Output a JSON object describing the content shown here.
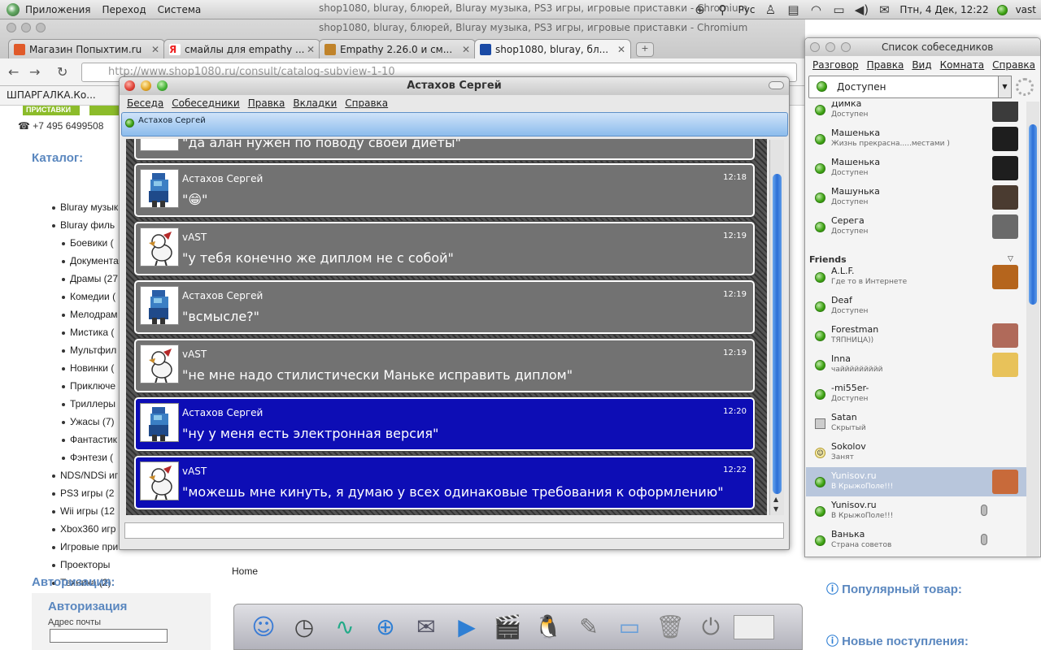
{
  "top_panel": {
    "menus": [
      "Приложения",
      "Переход",
      "Система"
    ],
    "window_title": "shop1080, bluray, блюрей, Bluray музыка, PS3 игры, игровые приставки - Chromium",
    "layout": "Рус",
    "datetime": "Птн, 4 Дек, 12:22",
    "user": "vast"
  },
  "browser": {
    "tabs": [
      {
        "label": "Магазин Попыхтим.ru",
        "color": "#e05a2a"
      },
      {
        "label": "смайлы для empathy ...",
        "color": "#ffffff"
      },
      {
        "label": "Empathy 2.26.0 и см...",
        "color": "#c0832a"
      },
      {
        "label": "shop1080, bluray, бл...",
        "color": "#1a4aa5"
      }
    ],
    "url_host": "http://www.shop1080.ru",
    "url_path": "/consult/catalog-subview-1-10",
    "bookmark": "ШПАРГАЛКА.Ко..."
  },
  "site": {
    "strip1": "ПРИСТАВКИ",
    "phone": "+7 495 6499508",
    "catalog_title": "Каталог:",
    "catalog": [
      {
        "label": "Bluray музык",
        "level": 0
      },
      {
        "label": "Bluray филь",
        "level": 0
      },
      {
        "label": "Боевики (",
        "level": 1
      },
      {
        "label": "Документа",
        "level": 1
      },
      {
        "label": "Драмы (27",
        "level": 1
      },
      {
        "label": "Комедии (",
        "level": 1
      },
      {
        "label": "Мелодрам",
        "level": 1
      },
      {
        "label": "Мистика (",
        "level": 1
      },
      {
        "label": "Мультфил",
        "level": 1
      },
      {
        "label": "Новинки (",
        "level": 1
      },
      {
        "label": "Приключе",
        "level": 1
      },
      {
        "label": "Триллеры",
        "level": 1
      },
      {
        "label": "Ужасы (7)",
        "level": 1
      },
      {
        "label": "Фантастик",
        "level": 1
      },
      {
        "label": "Фэнтези (",
        "level": 1
      },
      {
        "label": "NDS/NDSi иг",
        "level": 0
      },
      {
        "label": "PS3 игры (2",
        "level": 0
      },
      {
        "label": "Wii игры (12",
        "level": 0
      },
      {
        "label": "Xbox360 игр",
        "level": 0
      },
      {
        "label": "Игровые при",
        "level": 0
      },
      {
        "label": "Проекторы",
        "level": 0
      },
      {
        "label": "Техника (2)",
        "level": 0
      }
    ],
    "auth_header": "Авторизация:",
    "auth_title": "Авторизация",
    "email_label": "Адрес почты",
    "home": "Home",
    "popular": "Популярный товар:",
    "new_arrivals": "Новые поступления:"
  },
  "chat": {
    "title": "Астахов Сергей",
    "menu": [
      "Беседа",
      "Собеседники",
      "Правка",
      "Вкладки",
      "Справка"
    ],
    "tab_label": "Астахов Сергей",
    "partial_message": "\"да алан нужен по поводу своей диеты\"",
    "messages": [
      {
        "author": "Астахов Сергей",
        "time": "12:18",
        "text": "\"😁\"",
        "style": "gray",
        "avatar": "knight"
      },
      {
        "author": "vAST",
        "time": "12:19",
        "text": "\"у тебя конечно же диплом не с собой\"",
        "style": "gray",
        "avatar": "bird"
      },
      {
        "author": "Астахов Сергей",
        "time": "12:19",
        "text": "\"всмысле?\"",
        "style": "gray",
        "avatar": "knight"
      },
      {
        "author": "vAST",
        "time": "12:19",
        "text": "\"не мне надо стилистически Маньке исправить диплом\"",
        "style": "gray",
        "avatar": "bird"
      },
      {
        "author": "Астахов Сергей",
        "time": "12:20",
        "text": "\"ну у меня есть электронная версия\"",
        "style": "blue",
        "avatar": "knight"
      },
      {
        "author": "vAST",
        "time": "12:22",
        "text": "\"можешь мне кинуть, я думаю у всех одинаковые требования к оформлению\"",
        "style": "blue",
        "avatar": "bird"
      }
    ]
  },
  "contacts": {
    "title": "Список собеседников",
    "menu": [
      "Разговор",
      "Правка",
      "Вид",
      "Комната",
      "Справка"
    ],
    "presence": "Доступен",
    "group": "Friends",
    "list": [
      {
        "name": "Димка",
        "status": "Доступен",
        "state": "online",
        "avatar": "#3b3b3b"
      },
      {
        "name": "Машенька",
        "status": "Жизнь прекрасна.....местами )",
        "state": "online",
        "avatar": "#1e1e1e"
      },
      {
        "name": "Машенька",
        "status": "Доступен",
        "state": "online",
        "avatar": "#1e1e1e"
      },
      {
        "name": "Машунька",
        "status": "Доступен",
        "state": "online",
        "avatar": "#4a3b30"
      },
      {
        "name": "Серега",
        "status": "Доступен",
        "state": "online",
        "avatar": "#6a6a6a"
      },
      {
        "name": "A.L.F.",
        "status": "Где то в Интернете",
        "state": "online",
        "avatar": "#b5651d"
      },
      {
        "name": "Deaf",
        "status": "Доступен",
        "state": "online",
        "avatar": ""
      },
      {
        "name": "Forestman",
        "status": "ТЯПНИЦА))",
        "state": "online",
        "avatar": "#b06a5a"
      },
      {
        "name": "Inna",
        "status": "чаййййййййй",
        "state": "online",
        "avatar": "#e8c25a"
      },
      {
        "name": "-mi55er-",
        "status": "Доступен",
        "state": "online",
        "avatar": ""
      },
      {
        "name": "Satan",
        "status": "Скрытый",
        "state": "hidden",
        "avatar": ""
      },
      {
        "name": "Sokolov",
        "status": "Занят",
        "state": "busy",
        "avatar": ""
      },
      {
        "name": "Yunisov.ru",
        "status": "В КрыжоПоле!!!",
        "state": "online",
        "avatar": "#c86a3a",
        "selected": true
      },
      {
        "name": "Yunisov.ru",
        "status": "В КрыжоПоле!!!",
        "state": "online",
        "avatar": "",
        "mic": true
      },
      {
        "name": "Ванька",
        "status": "Страна советов",
        "state": "online",
        "avatar": "",
        "mic": true
      }
    ]
  },
  "dock": [
    "finder",
    "time-machine",
    "activity-monitor",
    "safari",
    "mail",
    "facetime",
    "imovie",
    "tux",
    "textedit",
    "folder",
    "trash",
    "power",
    "screen"
  ]
}
